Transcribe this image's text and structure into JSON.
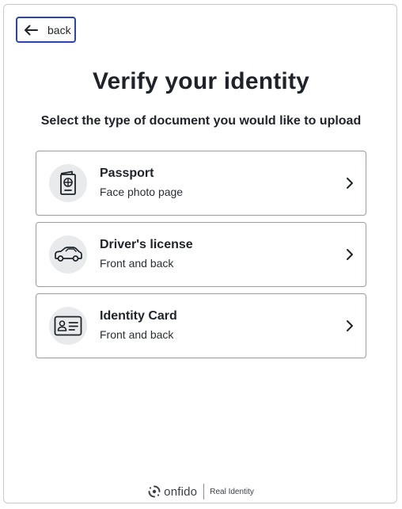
{
  "nav": {
    "back_label": "back"
  },
  "page": {
    "title": "Verify your identity",
    "subtitle": "Select the type of document you would like to upload"
  },
  "documents": [
    {
      "title": "Passport",
      "hint": "Face photo page",
      "icon": "passport-icon"
    },
    {
      "title": "Driver's license",
      "hint": "Front and back",
      "icon": "car-icon"
    },
    {
      "title": "Identity Card",
      "hint": "Front and back",
      "icon": "id-card-icon"
    }
  ],
  "footer": {
    "brand": "onfido",
    "tagline": "Real Identity"
  },
  "colors": {
    "accent": "#2b44b5",
    "text": "#1f2329",
    "border": "#9a9ca3",
    "icon_bg": "#e9eaec"
  }
}
